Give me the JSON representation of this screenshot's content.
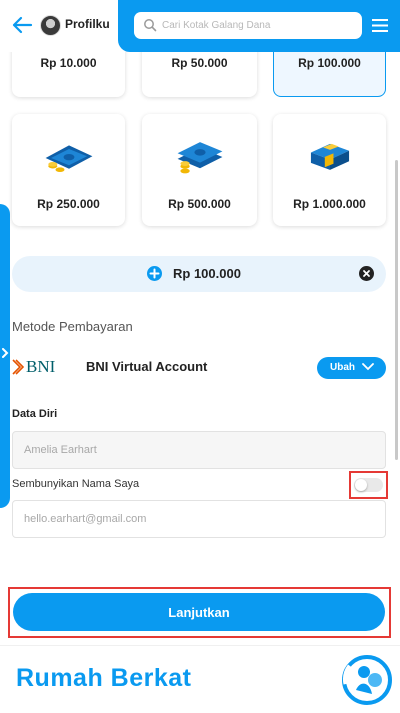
{
  "header": {
    "profile_label": "Profilku",
    "search_placeholder": "Cari Kotak Galang Dana"
  },
  "amounts": [
    {
      "label": "Rp 10.000",
      "selected": false
    },
    {
      "label": "Rp 50.000",
      "selected": false
    },
    {
      "label": "Rp 100.000",
      "selected": true
    },
    {
      "label": "Rp 250.000",
      "selected": false
    },
    {
      "label": "Rp 500.000",
      "selected": false
    },
    {
      "label": "Rp 1.000.000",
      "selected": false
    }
  ],
  "custom_amount": {
    "value": "Rp 100.000"
  },
  "payment": {
    "section_label": "Metode Pembayaran",
    "bank_logo_text": "BNI",
    "bank_name": "BNI Virtual Account",
    "change_label": "Ubah"
  },
  "personal": {
    "section_label": "Data Diri",
    "name_placeholder": "Amelia Earhart",
    "hide_name_label": "Sembunyikan Nama Saya",
    "hide_name_on": false,
    "email_placeholder": "hello.earhart@gmail.com"
  },
  "actions": {
    "continue_label": "Lanjutkan"
  },
  "footer": {
    "brand": "Rumah Berkat"
  },
  "colors": {
    "primary": "#0a9af0",
    "highlight": "#e53935",
    "bni_orange": "#e55300",
    "bni_teal": "#005e6a"
  }
}
